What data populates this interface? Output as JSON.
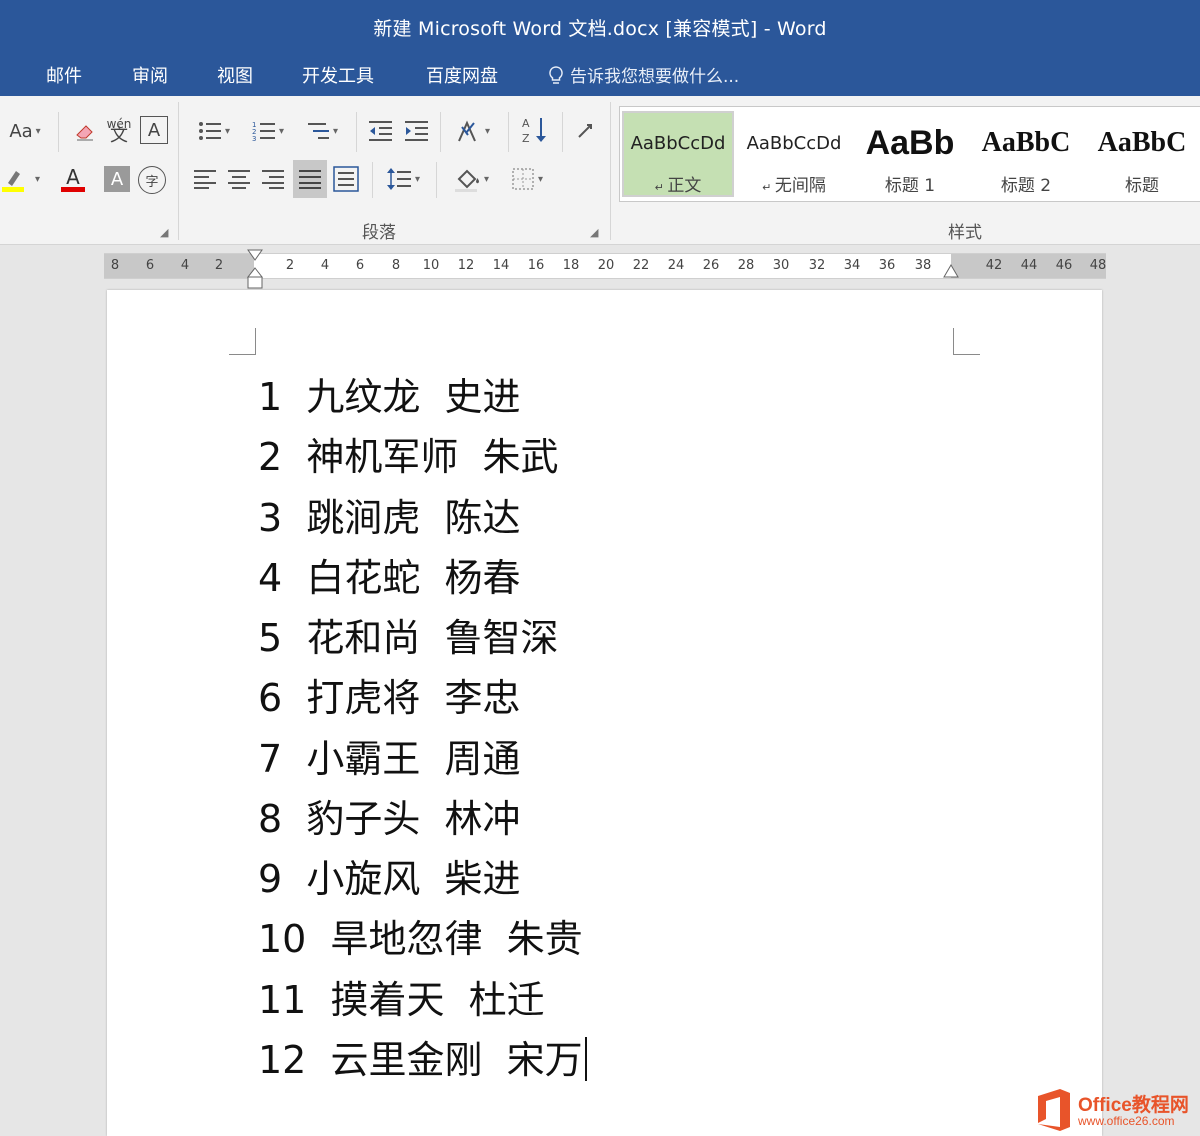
{
  "window": {
    "title": "新建 Microsoft Word 文档.docx [兼容模式] - Word"
  },
  "menu": {
    "tabs": [
      "邮件",
      "审阅",
      "视图",
      "开发工具",
      "百度网盘"
    ],
    "tell_me": "告诉我您想要做什么..."
  },
  "ribbon": {
    "font_group": {
      "change_case_label": "Aa",
      "phonetic_label": "wén",
      "font_color_label": "A",
      "char_shading_label": "A",
      "enclose_char_label": "字"
    },
    "paragraph_group": {
      "label": "段落"
    },
    "styles_group": {
      "label": "样式",
      "items": [
        {
          "preview": "AaBbCcDd",
          "name": "正文",
          "selected": true
        },
        {
          "preview": "AaBbCcDd",
          "name": "无间隔",
          "selected": false
        },
        {
          "preview": "AaBb",
          "name": "标题 1",
          "selected": false
        },
        {
          "preview": "AaBbC",
          "name": "标题 2",
          "selected": false
        },
        {
          "preview": "AaBbC",
          "name": "标题",
          "selected": false
        }
      ]
    }
  },
  "ruler": {
    "numbers": [
      "8",
      "6",
      "4",
      "2",
      "2",
      "4",
      "6",
      "8",
      "10",
      "12",
      "14",
      "16",
      "18",
      "20",
      "22",
      "24",
      "26",
      "28",
      "30",
      "32",
      "34",
      "36",
      "38",
      "42",
      "44",
      "46",
      "48"
    ]
  },
  "document": {
    "lines": [
      "1  九纹龙  史进",
      "2  神机军师  朱武",
      "3  跳涧虎  陈达",
      "4  白花蛇  杨春",
      "5  花和尚  鲁智深",
      "6  打虎将  李忠",
      "7  小霸王  周通",
      "8  豹子头  林冲",
      "9  小旋风  柴进",
      "10  旱地忽律  朱贵",
      "11  摸着天  杜迁",
      "12  云里金刚  宋万"
    ]
  },
  "watermark": {
    "title": "Office教程网",
    "url": "www.office26.com",
    "brand_color": "#e8542a"
  },
  "colors": {
    "title_bar": "#2b579a",
    "ribbon_bg": "#f3f3f3",
    "selected_style": "#c5e0b3"
  }
}
